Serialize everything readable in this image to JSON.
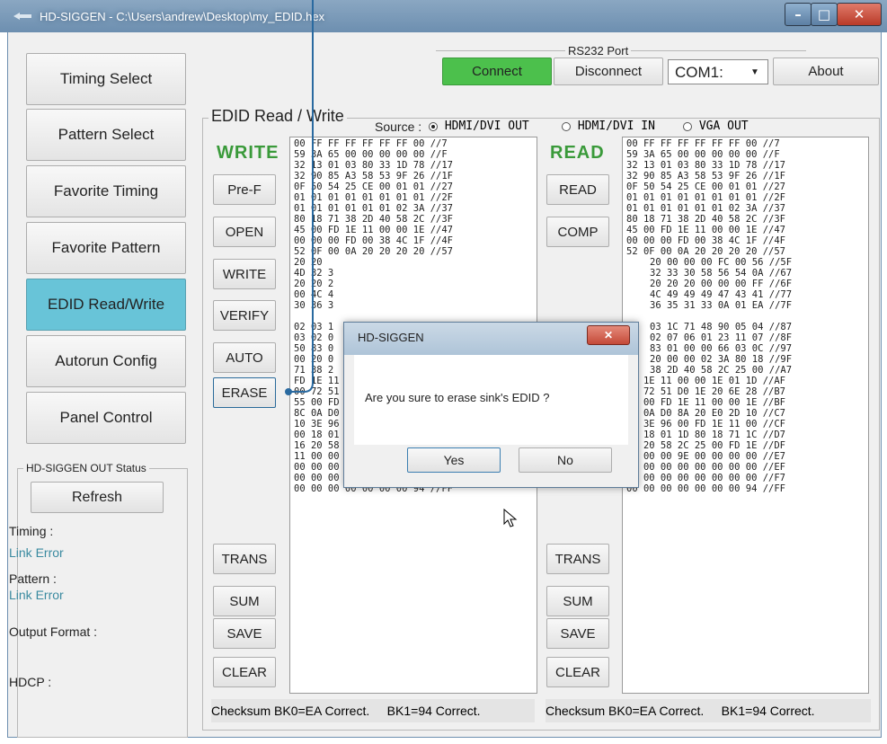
{
  "window": {
    "title": "HD-SIGGEN  - C:\\Users\\andrew\\Desktop\\my_EDID.hex",
    "minimize": "–",
    "maximize": "□",
    "close": "✕"
  },
  "nav": {
    "items": [
      {
        "label": "Timing Select"
      },
      {
        "label": "Pattern Select"
      },
      {
        "label": "Favorite Timing"
      },
      {
        "label": "Favorite Pattern"
      },
      {
        "label": "EDID Read/Write"
      },
      {
        "label": "Autorun Config"
      },
      {
        "label": "Panel Control"
      }
    ],
    "active_index": 4
  },
  "rs232": {
    "group_label": "RS232 Port",
    "connect_label": "Connect",
    "disconnect_label": "Disconnect",
    "port_value": "COM1:",
    "about_label": "About",
    "connect_color": "#4cc04c"
  },
  "status": {
    "group_label": "HD-SIGGEN OUT Status",
    "refresh_label": "Refresh",
    "timing_label": "Timing :",
    "timing_value": "Link Error",
    "pattern_label": "Pattern :",
    "pattern_value": "Link Error",
    "output_format_label": "Output Format :",
    "hdcp_label": "HDCP :"
  },
  "edid": {
    "group_label": "EDID Read / Write",
    "source_label": "Source :",
    "sources": [
      "HDMI/DVI OUT",
      "HDMI/DVI IN",
      "VGA OUT"
    ],
    "selected_source": 0,
    "write_heading": "WRITE",
    "read_heading": "READ",
    "write_buttons": [
      "Pre-F",
      "OPEN",
      "WRITE",
      "VERIFY",
      "AUTO",
      "ERASE"
    ],
    "write_buttons_bottom": [
      "TRANS",
      "SUM",
      "SAVE",
      "CLEAR"
    ],
    "read_buttons": [
      "READ",
      "COMP"
    ],
    "read_buttons_bottom": [
      "TRANS",
      "SUM",
      "SAVE",
      "CLEAR"
    ],
    "write_hex": [
      "00 FF FF FF FF FF FF 00 //7",
      "59 3A 65 00 00 00 00 00 //F",
      "32 13 01 03 80 33 1D 78 //17",
      "32 90 85 A3 58 53 9F 26 //1F",
      "0F 50 54 25 CE 00 01 01 //27",
      "01 01 01 01 01 01 01 01 //2F",
      "01 01 01 01 01 01 02 3A //37",
      "80 18 71 38 2D 40 58 2C //3F",
      "45 00 FD 1E 11 00 00 1E //47",
      "00 00 00 FD 00 38 4C 1F //4F",
      "52 0F 00 0A 20 20 20 20 //57",
      "20 20",
      "4D 32 3",
      "20 20 2",
      "00 4C 4",
      "30 36 3",
      "",
      "02 03 1",
      "03 02 0",
      "50 83 0",
      "00 20 0",
      "71 38 2",
      "FD 1E 11 00 00 1E 01 1D //AF",
      "00 72 51 D0 1E 20 6E 28 //B7",
      "55 00 FD 1E 11 00 00 1E //BF",
      "8C 0A D0 8A 20 E0 2D 10 //C7",
      "10 3E 96 00 FD 1E 11 00 //CF",
      "00 18 01 1D 80 18 71 1C //D7",
      "16 20 58 2C 25 00 FD 1E //DF",
      "11 00 00 9E 00 00 00 00 //E7",
      "00 00 00 00 00 00 00 00 //EF",
      "00 00 00 00 00 00 00 00 //F7",
      "00 00 00 00 00 00 00 94 //FF"
    ],
    "read_hex": [
      "00 FF FF FF FF FF FF 00 //7",
      "59 3A 65 00 00 00 00 00 //F",
      "32 13 01 03 80 33 1D 78 //17",
      "32 90 85 A3 58 53 9F 26 //1F",
      "0F 50 54 25 CE 00 01 01 //27",
      "01 01 01 01 01 01 01 01 //2F",
      "01 01 01 01 01 01 02 3A //37",
      "80 18 71 38 2D 40 58 2C //3F",
      "45 00 FD 1E 11 00 00 1E //47",
      "00 00 00 FD 00 38 4C 1F //4F",
      "52 0F 00 0A 20 20 20 20 //57",
      "20 00 00 00 FC 00 56 //5F",
      "32 33 30 58 56 54 0A //67",
      "20 20 20 00 00 00 FF //6F",
      "4C 49 49 49 47 43 41 //77",
      "36 35 31 33 0A 01 EA //7F",
      "",
      "03 1C 71 48 90 05 04 //87",
      "02 07 06 01 23 11 07 //8F",
      "83 01 00 00 66 03 0C //97",
      "20 00 00 02 3A 80 18 //9F",
      "38 2D 40 58 2C 25 00 //A7",
      "FD 1E 11 00 00 1E 01 1D //AF",
      "00 72 51 D0 1E 20 6E 28 //B7",
      "55 00 FD 1E 11 00 00 1E //BF",
      "8C 0A D0 8A 20 E0 2D 10 //C7",
      "10 3E 96 00 FD 1E 11 00 //CF",
      "00 18 01 1D 80 18 71 1C //D7",
      "16 20 58 2C 25 00 FD 1E //DF",
      "11 00 00 9E 00 00 00 00 //E7",
      "00 00 00 00 00 00 00 00 //EF",
      "00 00 00 00 00 00 00 00 //F7",
      "00 00 00 00 00 00 00 94 //FF"
    ],
    "write_checksum": "Checksum BK0=EA Correct.     BK1=94 Correct.",
    "read_checksum": "Checksum BK0=EA Correct.     BK1=94 Correct."
  },
  "dialog": {
    "title": "HD-SIGGEN",
    "message": "Are you sure to erase sink's EDID ?",
    "yes_label": "Yes",
    "no_label": "No",
    "close": "✕"
  }
}
